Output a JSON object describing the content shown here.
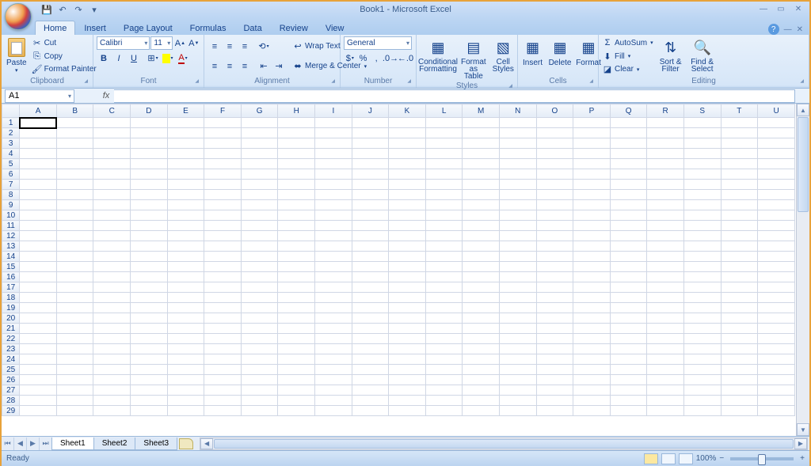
{
  "title": "Book1 - Microsoft Excel",
  "qat": {
    "save": "💾",
    "undo": "↶",
    "redo": "↷"
  },
  "tabs": [
    "Home",
    "Insert",
    "Page Layout",
    "Formulas",
    "Data",
    "Review",
    "View"
  ],
  "active_tab": 0,
  "ribbon": {
    "clipboard": {
      "label": "Clipboard",
      "paste": "Paste",
      "cut": "Cut",
      "copy": "Copy",
      "format_painter": "Format Painter"
    },
    "font": {
      "label": "Font",
      "name": "Calibri",
      "size": "11"
    },
    "alignment": {
      "label": "Alignment",
      "wrap": "Wrap Text",
      "merge": "Merge & Center"
    },
    "number": {
      "label": "Number",
      "format": "General"
    },
    "styles": {
      "label": "Styles",
      "cond": "Conditional Formatting",
      "table": "Format as Table",
      "cell": "Cell Styles"
    },
    "cells": {
      "label": "Cells",
      "insert": "Insert",
      "delete": "Delete",
      "format": "Format"
    },
    "editing": {
      "label": "Editing",
      "autosum": "AutoSum",
      "fill": "Fill",
      "clear": "Clear",
      "sort": "Sort & Filter",
      "find": "Find & Select"
    }
  },
  "namebox": "A1",
  "columns": [
    "A",
    "B",
    "C",
    "D",
    "E",
    "F",
    "G",
    "H",
    "I",
    "J",
    "K",
    "L",
    "M",
    "N",
    "O",
    "P",
    "Q",
    "R",
    "S",
    "T",
    "U"
  ],
  "rows": 29,
  "sheets": [
    "Sheet1",
    "Sheet2",
    "Sheet3"
  ],
  "active_sheet": 0,
  "status": "Ready",
  "zoom": "100%"
}
